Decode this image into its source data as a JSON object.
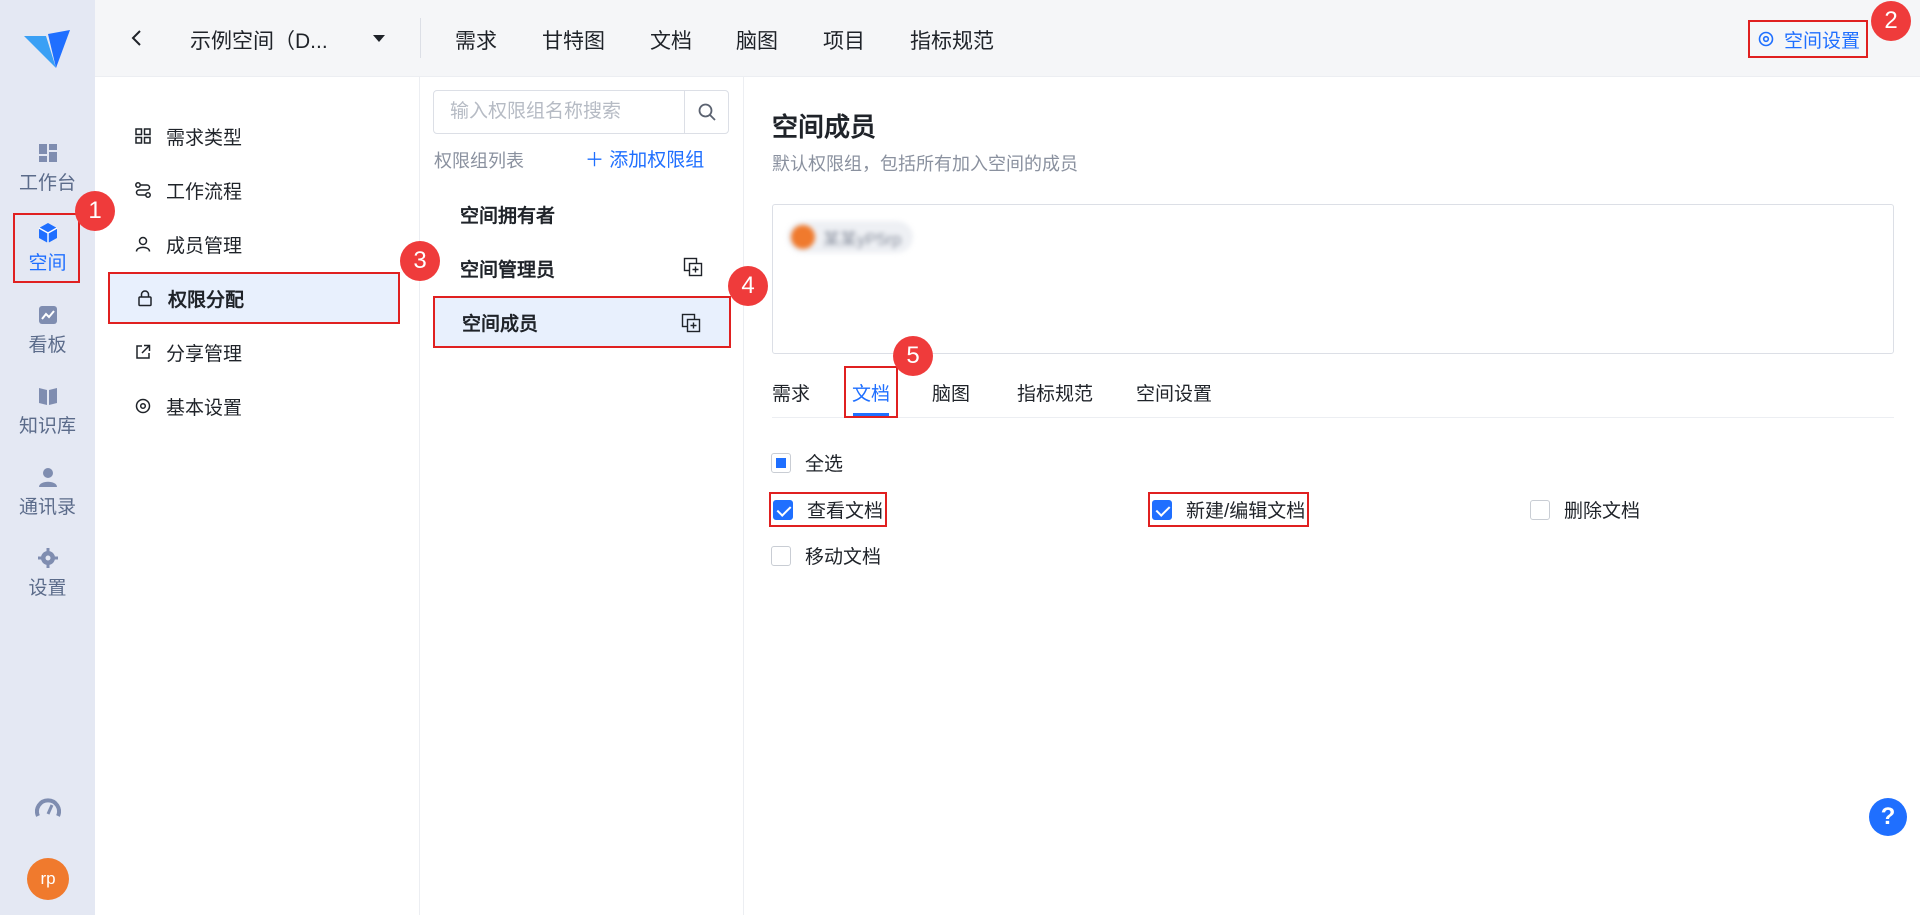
{
  "rail": {
    "items": [
      {
        "label": "工作台",
        "icon": "dashboard-icon"
      },
      {
        "label": "空间",
        "icon": "cube-icon",
        "active": true
      },
      {
        "label": "看板",
        "icon": "chart-icon"
      },
      {
        "label": "知识库",
        "icon": "book-icon"
      },
      {
        "label": "通讯录",
        "icon": "contacts-icon"
      },
      {
        "label": "设置",
        "icon": "gear-icon"
      }
    ],
    "avatar": "rp"
  },
  "topbar": {
    "space_name": "示例空间（D...",
    "nav": [
      "需求",
      "甘特图",
      "文档",
      "脑图",
      "项目",
      "指标规范"
    ],
    "settings_label": "空间设置"
  },
  "menu": {
    "items": [
      {
        "label": "需求类型",
        "icon": "grid-icon"
      },
      {
        "label": "工作流程",
        "icon": "workflow-icon"
      },
      {
        "label": "成员管理",
        "icon": "user-icon"
      },
      {
        "label": "权限分配",
        "icon": "lock-icon",
        "active": true
      },
      {
        "label": "分享管理",
        "icon": "share-icon"
      },
      {
        "label": "基本设置",
        "icon": "gear-icon"
      }
    ]
  },
  "groups": {
    "search_placeholder": "输入权限组名称搜索",
    "list_title": "权限组列表",
    "add_label": "添加权限组",
    "items": [
      {
        "label": "空间拥有者",
        "copyable": false
      },
      {
        "label": "空间管理员",
        "copyable": true
      },
      {
        "label": "空间成员",
        "copyable": true,
        "active": true
      }
    ]
  },
  "detail": {
    "title": "空间成员",
    "subtitle": "默认权限组，包括所有加入空间的成员",
    "member_chip": "某某yP5rp",
    "tabs": [
      "需求",
      "文档",
      "脑图",
      "指标规范",
      "空间设置"
    ],
    "active_tab": "文档",
    "select_all": "全选",
    "permissions": [
      {
        "label": "查看文档",
        "checked": true
      },
      {
        "label": "新建/编辑文档",
        "checked": true
      },
      {
        "label": "删除文档",
        "checked": false
      },
      {
        "label": "移动文档",
        "checked": false
      }
    ]
  },
  "annotations": [
    "1",
    "2",
    "3",
    "4",
    "5"
  ],
  "help": "?",
  "colors": {
    "accent": "#1f6fff",
    "annotation": "#ef3b3b",
    "rail_bg": "#e4e8f3",
    "selected_bg": "#e8f0fd"
  }
}
